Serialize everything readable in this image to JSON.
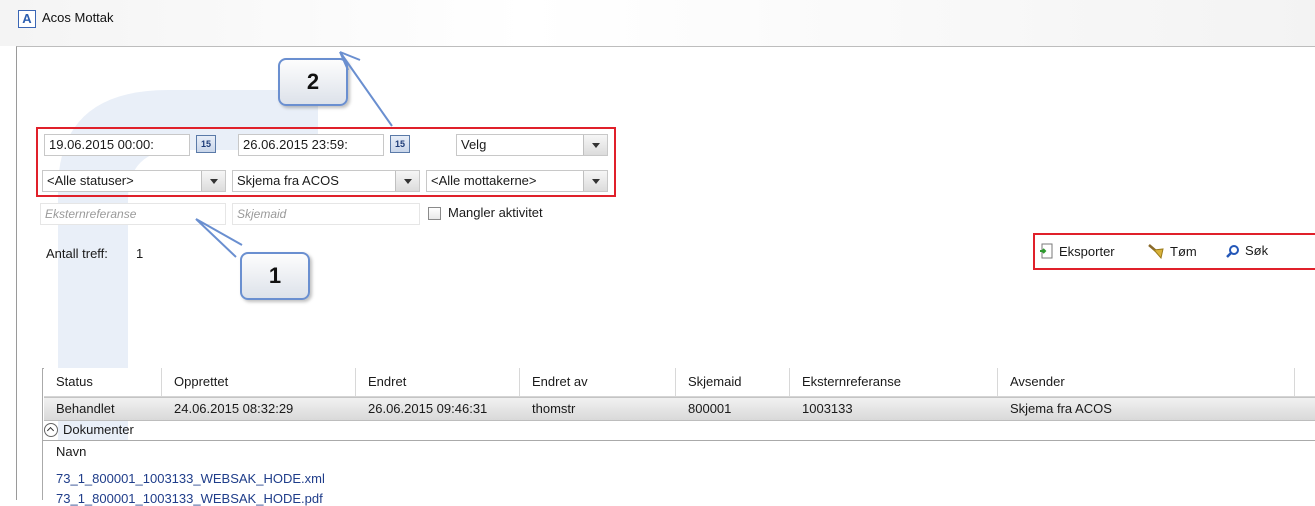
{
  "window": {
    "title": "Acos Mottak",
    "app_icon_letter": "A"
  },
  "filters": {
    "date_from": "19.06.2015 00:00:",
    "date_to": "26.06.2015 23:59:",
    "calendar_day": "15",
    "period_select": "Velg",
    "status_select": "<Alle statuser>",
    "form_select": "Skjema fra ACOS",
    "recipient_select": "<Alle mottakerne>",
    "external_ref_placeholder": "Eksternreferanse",
    "form_id_placeholder": "Skjemaid",
    "missing_activity_label": "Mangler aktivitet",
    "missing_activity_checked": false
  },
  "result_count": {
    "label": "Antall treff:",
    "value": "1"
  },
  "toolbar": {
    "export_label": "Eksporter",
    "clear_label": "Tøm",
    "search_label": "Søk"
  },
  "callouts": {
    "one": "1",
    "two": "2"
  },
  "table": {
    "columns": [
      "Status",
      "Opprettet",
      "Endret",
      "Endret av",
      "Skjemaid",
      "Eksternreferanse",
      "Avsender"
    ],
    "rows": [
      [
        "Behandlet",
        "24.06.2015 08:32:29",
        "26.06.2015 09:46:31",
        "thomstr",
        "800001",
        "1003133",
        "Skjema fra ACOS"
      ]
    ]
  },
  "documents": {
    "header": "Dokumenter",
    "column_name": "Navn",
    "files": [
      "73_1_800001_1003133_WEBSAK_HODE.xml",
      "73_1_800001_1003133_WEBSAK_HODE.pdf"
    ]
  },
  "colors": {
    "highlight_border": "#e0202a",
    "callout_border": "#6a8fd0",
    "link": "#1f3d8a",
    "selected_row": "#d9d9d9"
  },
  "icons": {
    "export": "export-icon",
    "clear": "broom-icon",
    "search": "search-icon",
    "calendar": "calendar-icon",
    "dropdown": "chevron-down-icon"
  }
}
